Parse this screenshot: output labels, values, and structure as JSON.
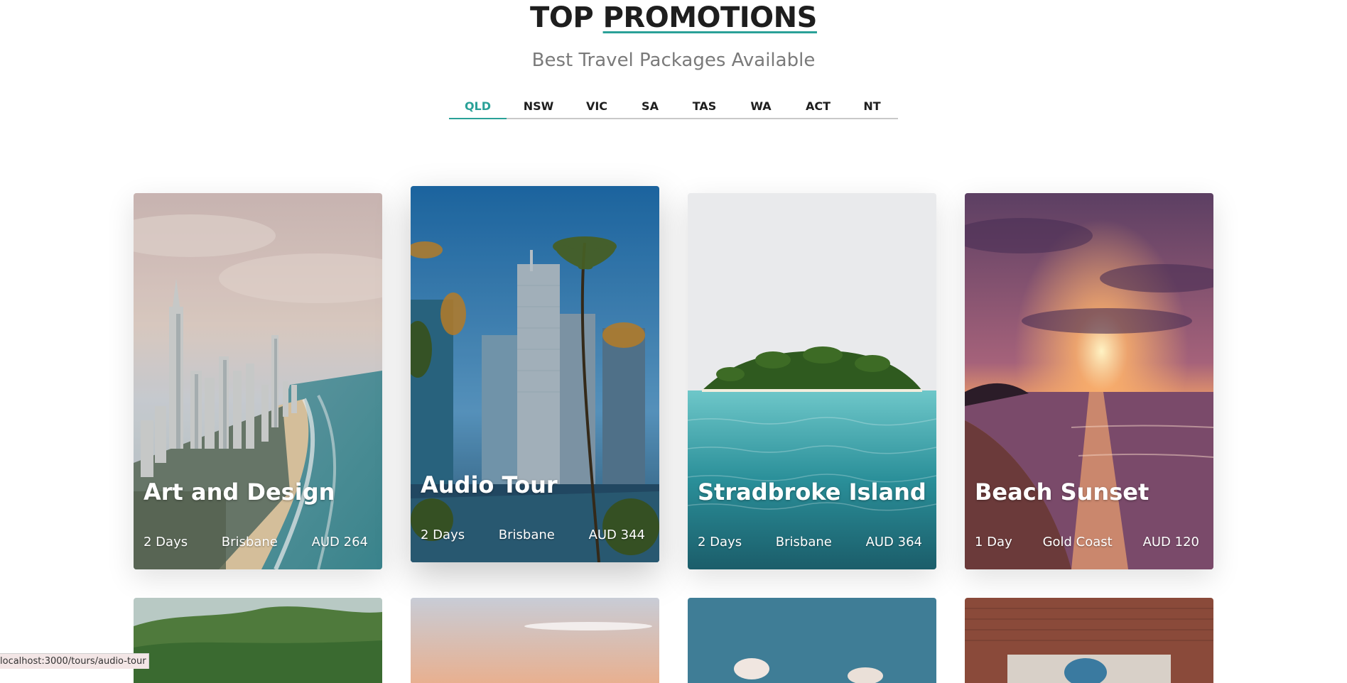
{
  "heading": {
    "part1": "TOP",
    "part2": "PROMOTIONS"
  },
  "subheading": "Best Travel Packages Available",
  "tabs": [
    "QLD",
    "NSW",
    "VIC",
    "SA",
    "TAS",
    "WA",
    "ACT",
    "NT"
  ],
  "active_tab": "QLD",
  "accent_color": "#2aa198",
  "cards": [
    {
      "title": "Art and Design",
      "duration": "2 Days",
      "location": "Brisbane",
      "price": "AUD 264"
    },
    {
      "title": "Audio Tour",
      "duration": "2 Days",
      "location": "Brisbane",
      "price": "AUD 344"
    },
    {
      "title": "Stradbroke Island",
      "duration": "2 Days",
      "location": "Brisbane",
      "price": "AUD 364"
    },
    {
      "title": "Beach Sunset",
      "duration": "1 Day",
      "location": "Gold Coast",
      "price": "AUD 120"
    }
  ],
  "status_url": "localhost:3000/tours/audio-tour"
}
